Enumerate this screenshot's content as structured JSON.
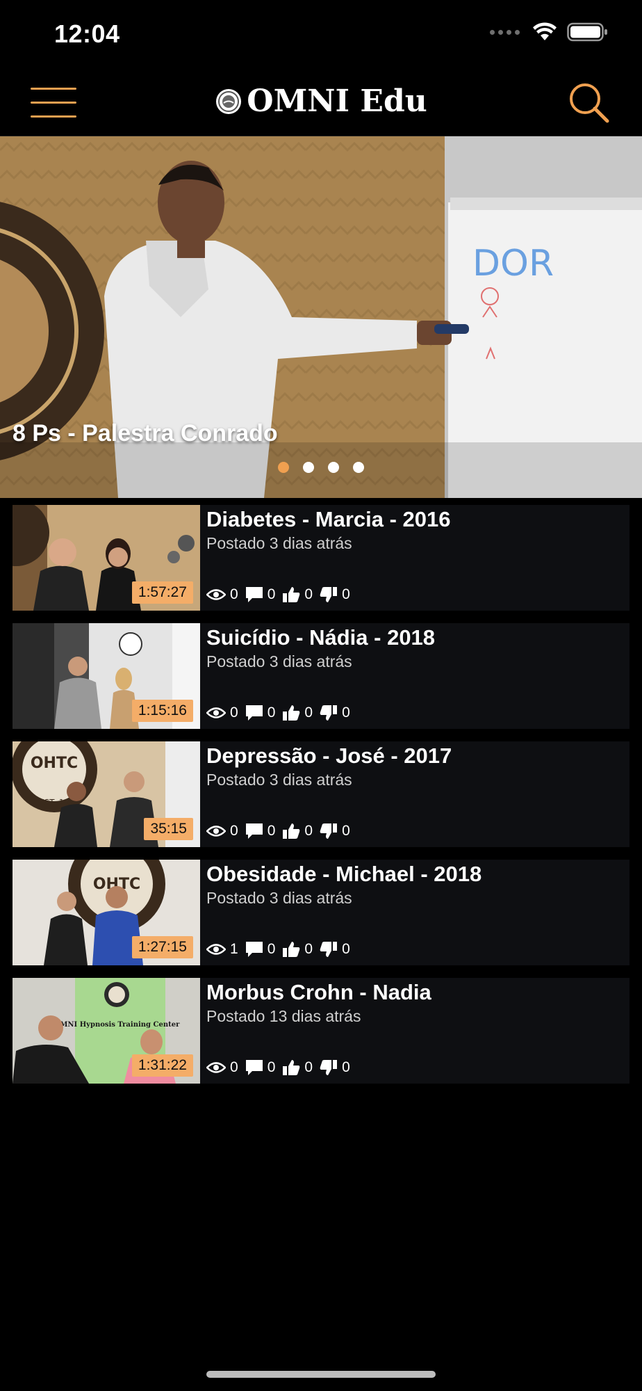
{
  "status_bar": {
    "time": "12:04"
  },
  "app_bar": {
    "title": "OMNI Edu",
    "menu_icon": "hamburger-menu-icon",
    "search_icon": "search-icon",
    "accent_color": "#f0a050"
  },
  "hero": {
    "title": "8 Ps - Palestra Conrado",
    "whiteboard_text": "DOR",
    "slide_count": 4,
    "active_slide": 1
  },
  "videos": [
    {
      "title": "Diabetes - Marcia - 2016",
      "posted": "Postado 3 dias atrás",
      "duration": "1:57:27",
      "views": "0",
      "comments": "0",
      "likes": "0",
      "dislikes": "0"
    },
    {
      "title": "Suicídio - Nádia - 2018",
      "posted": "Postado 3 dias atrás",
      "duration": "1:15:16",
      "views": "0",
      "comments": "0",
      "likes": "0",
      "dislikes": "0"
    },
    {
      "title": "Depressão - José - 2017",
      "posted": "Postado 3 dias atrás",
      "duration": "35:15",
      "views": "0",
      "comments": "0",
      "likes": "0",
      "dislikes": "0"
    },
    {
      "title": "Obesidade - Michael - 2018",
      "posted": "Postado 3 dias atrás",
      "duration": "1:27:15",
      "views": "1",
      "comments": "0",
      "likes": "0",
      "dislikes": "0"
    },
    {
      "title": "Morbus Crohn - Nadia",
      "posted": "Postado 13 dias atrás",
      "duration": "1:31:22",
      "views": "0",
      "comments": "0",
      "likes": "0",
      "dislikes": "0"
    }
  ],
  "thumb_text": {
    "ohtc": "OHTC",
    "est": "EST. 19",
    "omni_banner": "OMNI Hypnosis Training Center"
  }
}
